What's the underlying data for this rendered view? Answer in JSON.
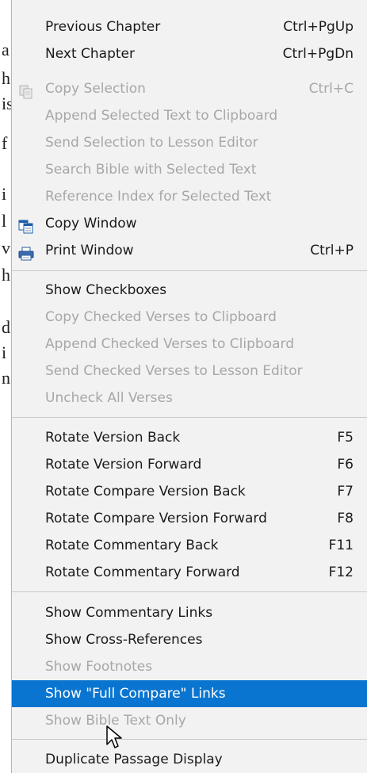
{
  "background_letters": [
    "a",
    "h",
    "is",
    "f",
    "i",
    "l",
    "v",
    "h",
    "d",
    "i",
    "n"
  ],
  "menu": {
    "items": [
      {
        "label": "Previous Chapter",
        "shortcut": "Ctrl+PgUp",
        "enabled": true
      },
      {
        "label": "Next Chapter",
        "shortcut": "Ctrl+PgDn",
        "enabled": true
      },
      {
        "label": "Copy Selection",
        "shortcut": "Ctrl+C",
        "enabled": false,
        "icon": "copy-icon"
      },
      {
        "label": "Append Selected Text to Clipboard",
        "shortcut": "",
        "enabled": false
      },
      {
        "label": "Send Selection to Lesson Editor",
        "shortcut": "",
        "enabled": false
      },
      {
        "label": "Search Bible with Selected Text",
        "shortcut": "",
        "enabled": false
      },
      {
        "label": "Reference Index for Selected Text",
        "shortcut": "",
        "enabled": false
      },
      {
        "label": "Copy Window",
        "shortcut": "",
        "enabled": true,
        "icon": "copy-window-icon"
      },
      {
        "label": "Print Window",
        "shortcut": "Ctrl+P",
        "enabled": true,
        "icon": "print-icon"
      },
      {
        "label": "Show Checkboxes",
        "shortcut": "",
        "enabled": true
      },
      {
        "label": "Copy Checked Verses to Clipboard",
        "shortcut": "",
        "enabled": false
      },
      {
        "label": "Append Checked Verses to Clipboard",
        "shortcut": "",
        "enabled": false
      },
      {
        "label": "Send Checked Verses to Lesson Editor",
        "shortcut": "",
        "enabled": false
      },
      {
        "label": "Uncheck All Verses",
        "shortcut": "",
        "enabled": false
      },
      {
        "label": "Rotate Version Back",
        "shortcut": "F5",
        "enabled": true
      },
      {
        "label": "Rotate Version Forward",
        "shortcut": "F6",
        "enabled": true
      },
      {
        "label": "Rotate Compare Version Back",
        "shortcut": "F7",
        "enabled": true
      },
      {
        "label": "Rotate Compare Version Forward",
        "shortcut": "F8",
        "enabled": true
      },
      {
        "label": "Rotate Commentary Back",
        "shortcut": "F11",
        "enabled": true
      },
      {
        "label": "Rotate Commentary Forward",
        "shortcut": "F12",
        "enabled": true
      },
      {
        "label": "Show Commentary Links",
        "shortcut": "",
        "enabled": true
      },
      {
        "label": "Show Cross-References",
        "shortcut": "",
        "enabled": true
      },
      {
        "label": "Show Footnotes",
        "shortcut": "",
        "enabled": false
      },
      {
        "label": "Show \"Full Compare\" Links",
        "shortcut": "",
        "enabled": true,
        "selected": true
      },
      {
        "label": "Show Bible Text Only",
        "shortcut": "",
        "enabled": false
      },
      {
        "label": "Duplicate Passage Display",
        "shortcut": "",
        "enabled": true
      }
    ]
  },
  "colors": {
    "menu_bg": "#f2f2f2",
    "highlight": "#0a75d0",
    "disabled_text": "#a7a7a7",
    "text": "#1a1a1a"
  }
}
